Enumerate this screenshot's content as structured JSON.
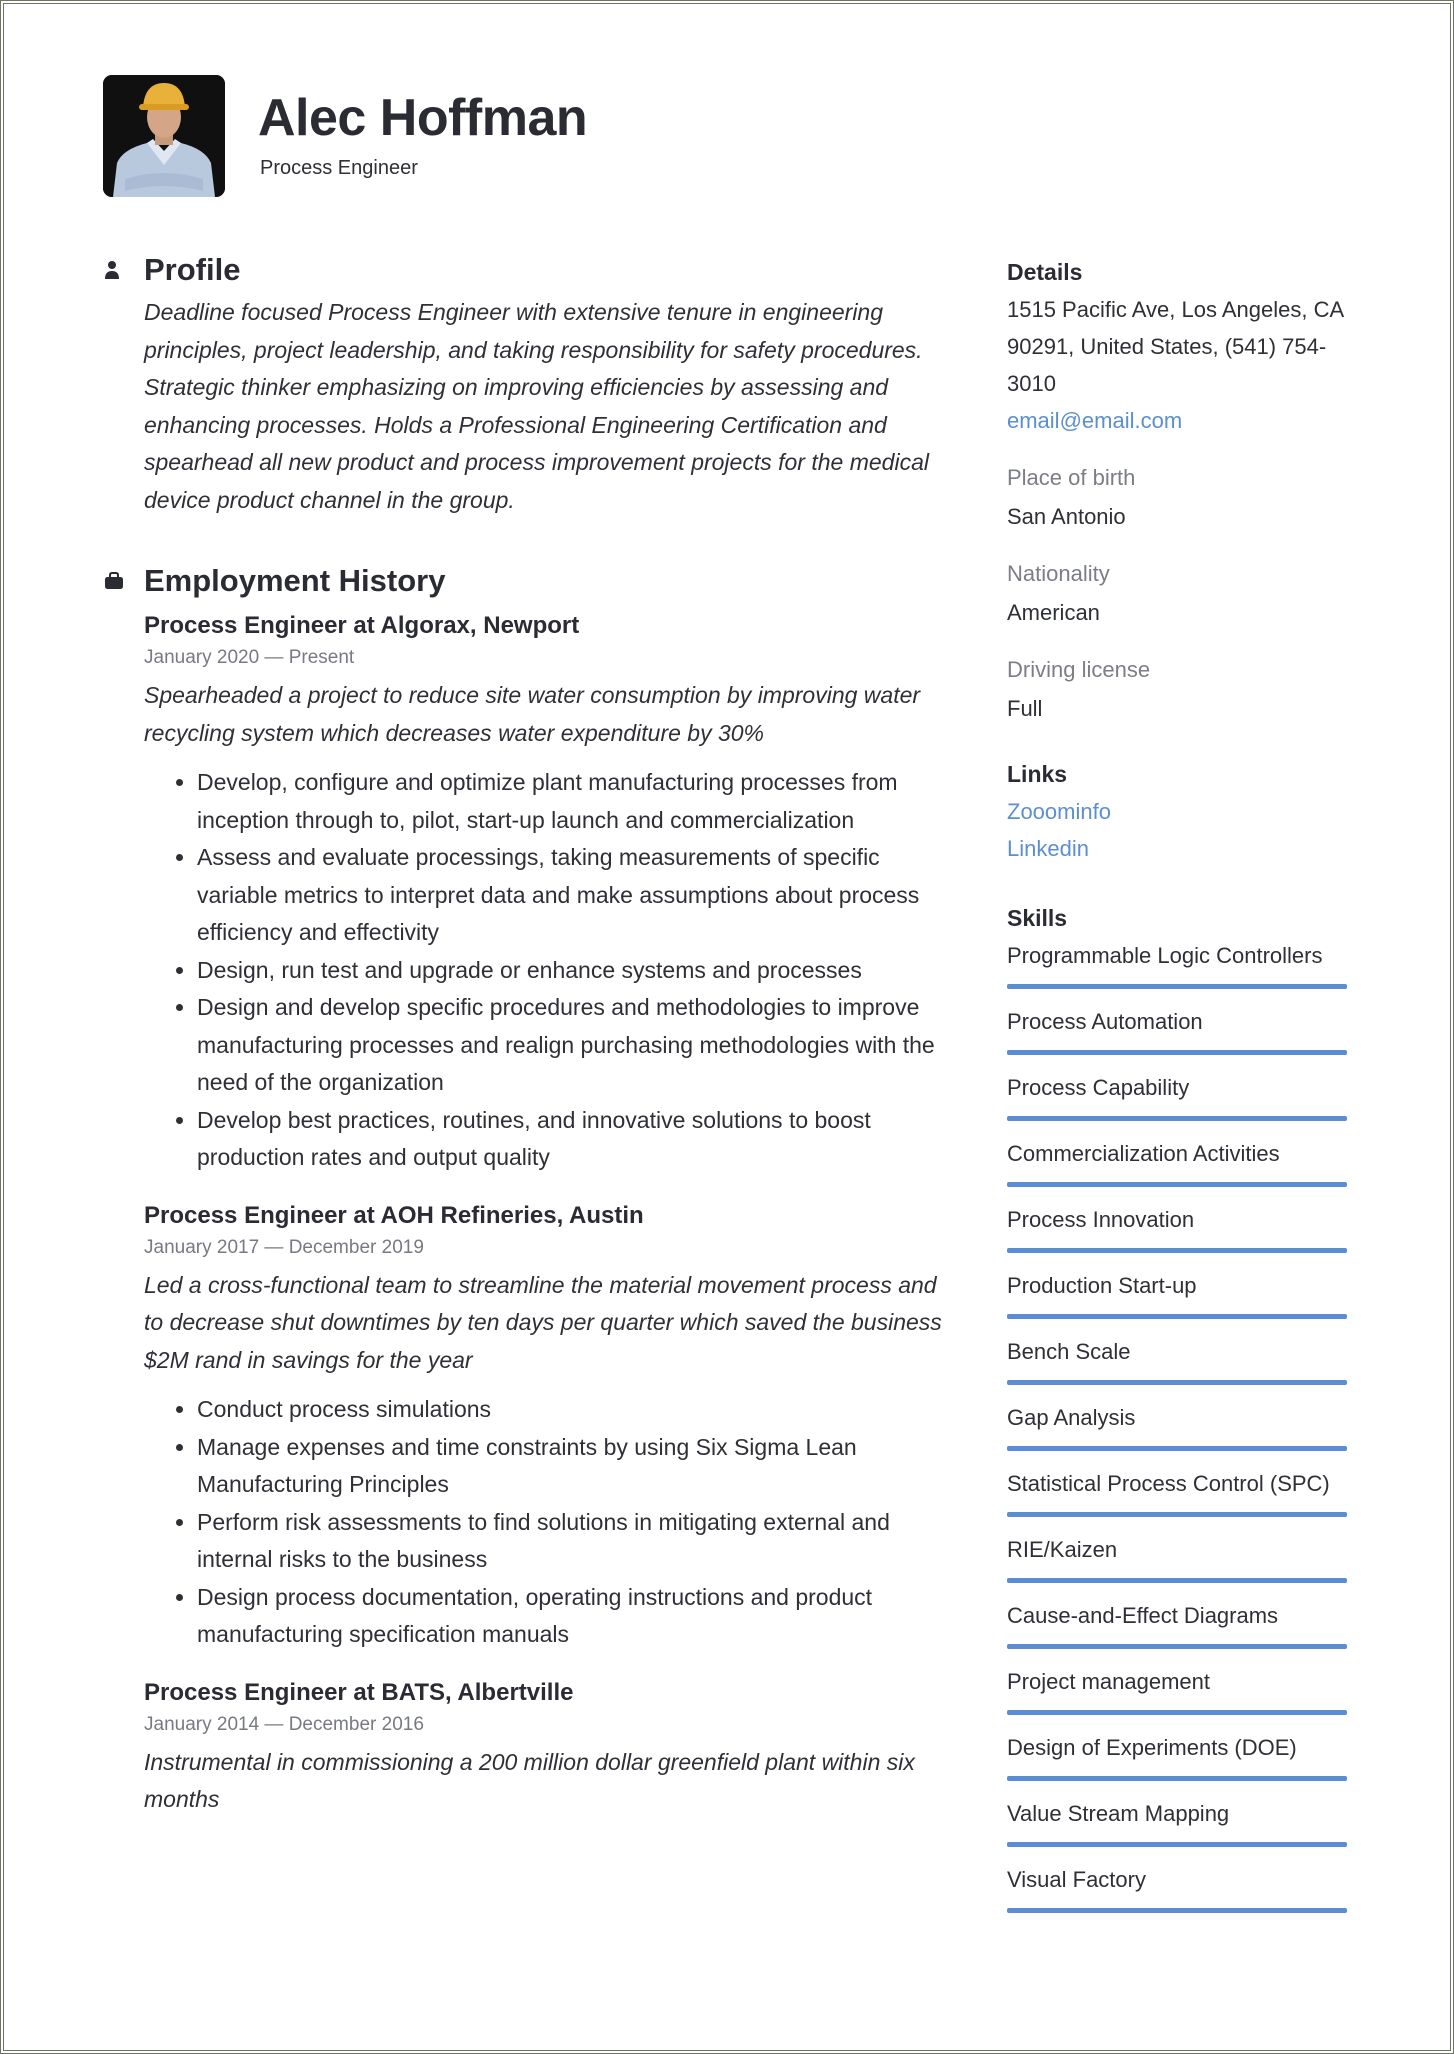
{
  "header": {
    "name": "Alec Hoffman",
    "title": "Process Engineer",
    "photo": "avatar-photo"
  },
  "profile": {
    "heading": "Profile",
    "icon": "person-icon",
    "text": "Deadline focused Process Engineer with extensive tenure in engineering principles, project leadership, and taking responsibility for safety procedures. Strategic thinker emphasizing on improving efficiencies by assessing and enhancing processes. Holds a Professional Engineering Certification and spearhead all new product and process improvement projects for the medical device product channel in the group."
  },
  "employment": {
    "heading": "Employment History",
    "icon": "briefcase-icon",
    "jobs": [
      {
        "title": "Process Engineer at Algorax, Newport",
        "dates": "January 2020 — Present",
        "summary": "Spearheaded a project to reduce site water consumption by improving water recycling system which decreases water expenditure by 30%",
        "bullets": [
          "Develop, configure and optimize plant manufacturing processes from inception through to, pilot, start-up launch and commercialization",
          "Assess and evaluate processings, taking measurements of specific variable metrics to interpret data and make assumptions about process efficiency and effectivity",
          "Design, run test and upgrade or enhance systems and processes",
          "Design and develop specific procedures and methodologies to improve manufacturing processes and realign purchasing methodologies with the need of the organization",
          "Develop best practices, routines, and innovative solutions to boost production rates and output quality"
        ]
      },
      {
        "title": "Process Engineer at AOH Refineries, Austin",
        "dates": "January 2017 — December 2019",
        "summary": "Led a cross-functional team to streamline the material movement process and to decrease shut downtimes by ten days per quarter which saved the business $2M rand in savings for the year",
        "bullets": [
          "Conduct process simulations",
          "Manage expenses and time constraints by using Six Sigma Lean Manufacturing Principles",
          "Perform risk assessments to find solutions in mitigating external and internal risks to the business",
          "Design process documentation, operating instructions and product manufacturing specification manuals"
        ]
      },
      {
        "title": "Process Engineer at BATS, Albertville",
        "dates": "January 2014 — December 2016",
        "summary": "Instrumental in commissioning a 200 million dollar greenfield plant within six months",
        "bullets": []
      }
    ]
  },
  "details": {
    "heading": "Details",
    "address": "1515 Pacific Ave, Los Angeles, CA 90291, United States, (541) 754-3010",
    "email": "email@email.com",
    "place_of_birth_label": "Place of birth",
    "place_of_birth": "San Antonio",
    "nationality_label": "Nationality",
    "nationality": "American",
    "driving_license_label": "Driving license",
    "driving_license": "Full"
  },
  "links": {
    "heading": "Links",
    "items": [
      "Zooominfo",
      "Linkedin"
    ]
  },
  "skills": {
    "heading": "Skills",
    "accent_color": "#5b8dd6",
    "items": [
      {
        "name": "Programmable Logic Controllers",
        "level": 1.0
      },
      {
        "name": "Process Automation",
        "level": 1.0
      },
      {
        "name": "Process Capability",
        "level": 1.0
      },
      {
        "name": "Commercialization Activities",
        "level": 1.0
      },
      {
        "name": "Process Innovation",
        "level": 1.0
      },
      {
        "name": "Production Start-up",
        "level": 1.0
      },
      {
        "name": "Bench Scale",
        "level": 1.0
      },
      {
        "name": "Gap Analysis",
        "level": 1.0
      },
      {
        "name": "Statistical Process Control (SPC)",
        "level": 1.0
      },
      {
        "name": "RIE/Kaizen",
        "level": 1.0
      },
      {
        "name": "Cause-and-Effect Diagrams",
        "level": 1.0
      },
      {
        "name": "Project management",
        "level": 1.0
      },
      {
        "name": "Design of Experiments (DOE)",
        "level": 1.0
      },
      {
        "name": "Value Stream Mapping",
        "level": 1.0
      },
      {
        "name": "Visual Factory",
        "level": 1.0
      }
    ]
  }
}
